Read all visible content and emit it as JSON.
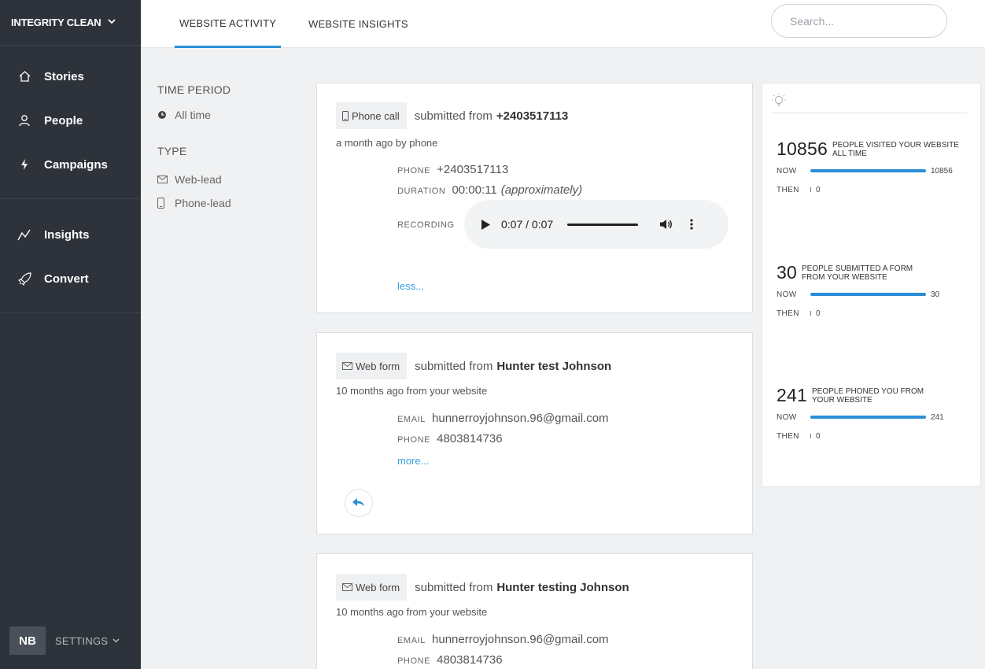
{
  "org": {
    "name": "INTEGRITY CLEAN"
  },
  "nav": {
    "group1": [
      {
        "label": "Stories",
        "icon": "home-icon"
      },
      {
        "label": "People",
        "icon": "person-icon"
      },
      {
        "label": "Campaigns",
        "icon": "bolt-icon"
      }
    ],
    "group2": [
      {
        "label": "Insights",
        "icon": "trend-icon"
      },
      {
        "label": "Convert",
        "icon": "rocket-icon"
      }
    ]
  },
  "user": {
    "initials": "NB",
    "settings_label": "SETTINGS"
  },
  "tabs": [
    {
      "label": "WEBSITE ACTIVITY",
      "active": true
    },
    {
      "label": "WEBSITE INSIGHTS",
      "active": false
    }
  ],
  "search": {
    "placeholder": "Search...",
    "value": ""
  },
  "filters": {
    "time_heading": "TIME PERIOD",
    "time_value": "All time",
    "type_heading": "TYPE",
    "types": [
      "Web-lead",
      "Phone-lead"
    ]
  },
  "activities": [
    {
      "badge": "Phone call",
      "submitted_prefix": "submitted from",
      "source": "+2403517113",
      "meta": "a month ago by phone",
      "fields": [
        {
          "label": "PHONE",
          "value": "+2403517113"
        },
        {
          "label": "DURATION",
          "value": "00:00:11",
          "note": "(approximately)"
        },
        {
          "label": "RECORDING",
          "value": ""
        }
      ],
      "audio_time": "0:07 / 0:07",
      "link": "less..."
    },
    {
      "badge": "Web form",
      "submitted_prefix": "submitted from",
      "source": "Hunter test Johnson",
      "meta": "10 months ago from your website",
      "fields": [
        {
          "label": "EMAIL",
          "value": "hunnerroyjohnson.96@gmail.com"
        },
        {
          "label": "PHONE",
          "value": "4803814736"
        }
      ],
      "link": "more..."
    },
    {
      "badge": "Web form",
      "submitted_prefix": "submitted from",
      "source": "Hunter testing Johnson",
      "meta": "10 months ago from your website",
      "fields": [
        {
          "label": "EMAIL",
          "value": "hunnerroyjohnson.96@gmail.com"
        },
        {
          "label": "PHONE",
          "value": "4803814736"
        }
      ]
    }
  ],
  "insights": {
    "accent": "#2b8ed7",
    "stats": [
      {
        "number": "10856",
        "description": "PEOPLE VISITED YOUR WEBSITE ALL TIME",
        "now_label": "NOW",
        "now_value": "10856",
        "then_label": "THEN",
        "then_value": "0"
      },
      {
        "number": "30",
        "description": "PEOPLE SUBMITTED A FORM FROM YOUR WEBSITE",
        "now_label": "NOW",
        "now_value": "30",
        "then_label": "THEN",
        "then_value": "0"
      },
      {
        "number": "241",
        "description": "PEOPLE PHONED YOU FROM YOUR WEBSITE",
        "now_label": "NOW",
        "now_value": "241",
        "then_label": "THEN",
        "then_value": "0"
      }
    ]
  }
}
